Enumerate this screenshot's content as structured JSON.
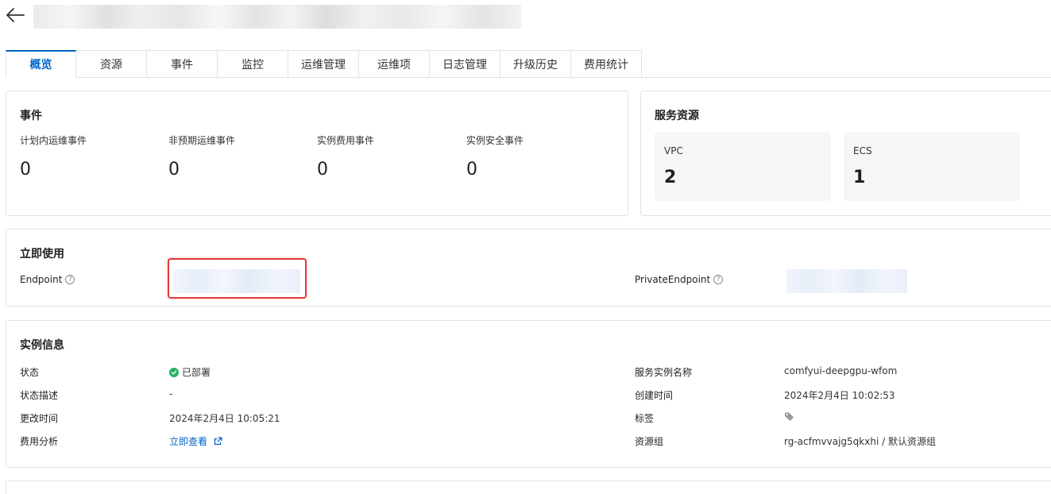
{
  "header": {
    "back_icon": "arrow-left-icon"
  },
  "tabs": [
    {
      "label": "概览",
      "active": true
    },
    {
      "label": "资源"
    },
    {
      "label": "事件"
    },
    {
      "label": "监控"
    },
    {
      "label": "运维管理"
    },
    {
      "label": "运维项"
    },
    {
      "label": "日志管理"
    },
    {
      "label": "升级历史"
    },
    {
      "label": "费用统计"
    }
  ],
  "events": {
    "title": "事件",
    "items": [
      {
        "label": "计划内运维事件",
        "value": "0"
      },
      {
        "label": "非预期运维事件",
        "value": "0"
      },
      {
        "label": "实例费用事件",
        "value": "0"
      },
      {
        "label": "实例安全事件",
        "value": "0"
      }
    ]
  },
  "service_resources": {
    "title": "服务资源",
    "items": [
      {
        "label": "VPC",
        "value": "2"
      },
      {
        "label": "ECS",
        "value": "1"
      }
    ]
  },
  "quick_use": {
    "title": "立即使用",
    "endpoint_label": "Endpoint",
    "private_endpoint_label": "PrivateEndpoint",
    "help_icon": "question-circle-icon",
    "highlight_color": "#e23a3a"
  },
  "instance_info": {
    "title": "实例信息",
    "status_label": "状态",
    "status_value": "已部署",
    "status_color": "#23b066",
    "status_desc_label": "状态描述",
    "status_desc_value": "-",
    "updated_label": "更改时间",
    "updated_value": "2024年2月4日 10:05:21",
    "cost_label": "费用分析",
    "cost_link": "立即查看",
    "name_label": "服务实例名称",
    "name_value": "comfyui-deepgpu-wfom",
    "created_label": "创建时间",
    "created_value": "2024年2月4日 10:02:53",
    "tag_label": "标签",
    "tag_icon": "tag-icon",
    "rg_label": "资源组",
    "rg_value": "rg-acfmvvajg5qkxhi / 默认资源组"
  },
  "colors": {
    "accent": "#0064c8",
    "border": "#e3e3e3"
  }
}
